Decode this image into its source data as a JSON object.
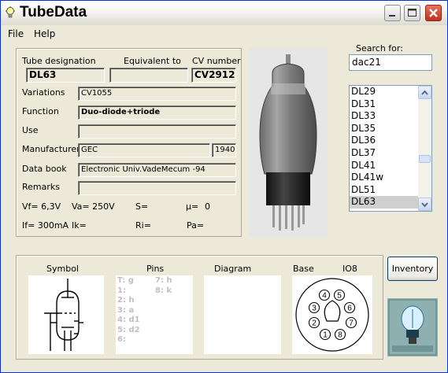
{
  "window": {
    "title": "TubeData"
  },
  "menu": {
    "file": "File",
    "help": "Help"
  },
  "details": {
    "designation_label": "Tube designation",
    "equivalent_label": "Equivalent to",
    "cv_label": "CV number",
    "designation": "DL63",
    "equivalent": "",
    "cv_number": "CV2912",
    "variations_label": "Variations",
    "variations": "CV1055",
    "function_label": "Function",
    "function": "Duo-diode+triode",
    "use_label": "Use",
    "use": "",
    "manufacturer_label": "Manufacturer",
    "manufacturer": "GEC",
    "year": "1940",
    "databook_label": "Data book",
    "databook": "Electronic Univ.VadeMecum -94",
    "remarks_label": "Remarks",
    "remarks": "",
    "vf": "Vf= 6,3V",
    "va": "Va= 250V",
    "s": "S=",
    "mu": "μ=",
    "mu_value": "0",
    "if": "If= 300mA",
    "ik": "Ik=",
    "ri": "Ri=",
    "pa": "Pa="
  },
  "search": {
    "label": "Search for:",
    "value": "dac21",
    "items": [
      "DL29",
      "DL31",
      "DL33",
      "DL35",
      "DL36",
      "DL37",
      "DL41",
      "DL41w",
      "DL51",
      "DL63"
    ],
    "selected": "DL63"
  },
  "bottom": {
    "symbol_label": "Symbol",
    "pins_label": "Pins",
    "diagram_label": "Diagram",
    "base_label": "Base",
    "base_type": "IO8",
    "pins_col1": [
      "T: g",
      "1:",
      "2: h",
      "3: a",
      "4: d1",
      "5: d2",
      "6:"
    ],
    "pins_col2": [
      "7: h",
      "8: k"
    ],
    "base_pins": [
      "1",
      "2",
      "3",
      "4",
      "5",
      "6",
      "7",
      "8"
    ]
  },
  "inventory_button": "Inventory",
  "colors": {
    "titlebar_border": "#0831d9",
    "close_button": "#c1301a",
    "selection": "#cfcfcf"
  },
  "icons": [
    "lightbulb-icon",
    "minimize-icon",
    "maximize-icon",
    "close-icon",
    "scroll-up-icon",
    "scroll-down-icon",
    "tube-photo",
    "logo-image"
  ]
}
